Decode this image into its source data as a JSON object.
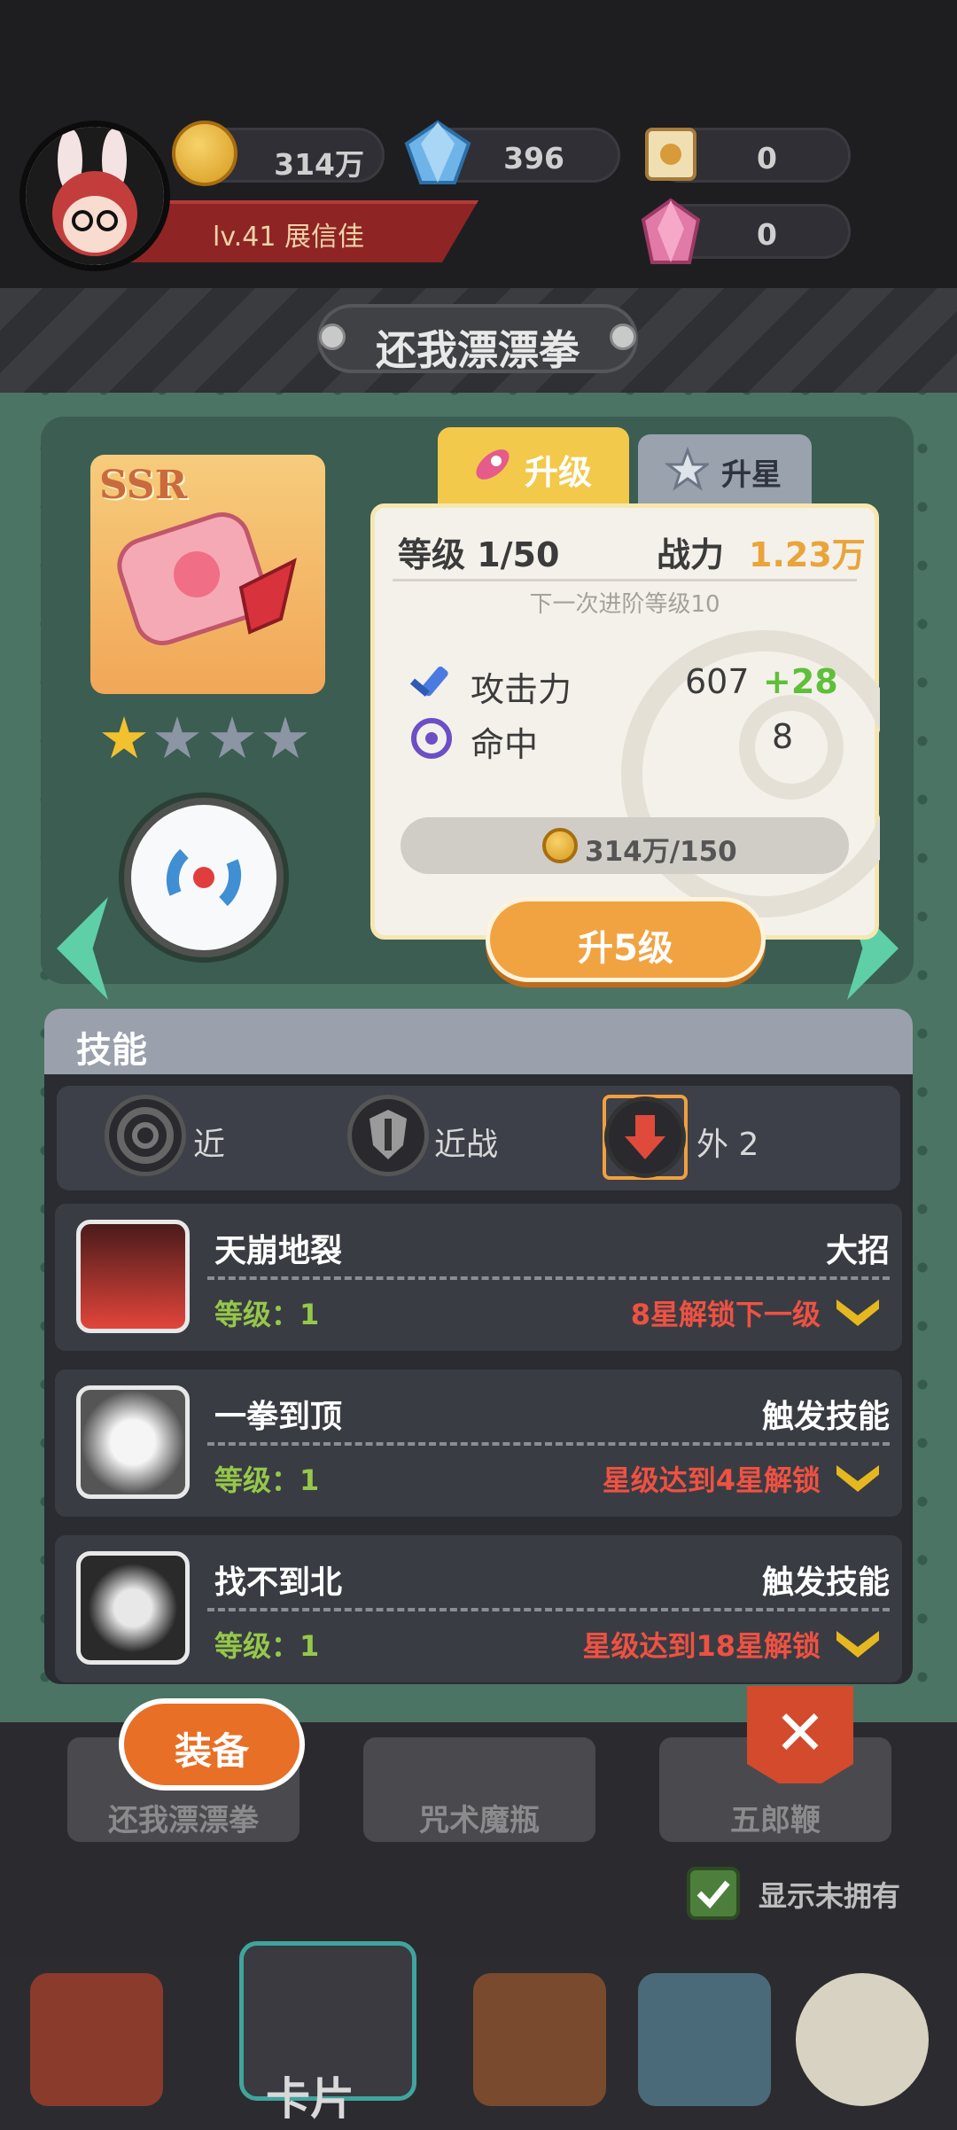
{
  "player": {
    "level_name": "lv.41  展信佳"
  },
  "currencies": {
    "gold": "314万",
    "diamond": "396",
    "scroll": "0",
    "gem": "0"
  },
  "title": "还我漂漂拳",
  "card": {
    "rarity": "SSR",
    "stars_filled": 1,
    "stars_total": 4
  },
  "tabs": {
    "upgrade": "升级",
    "star_up": "升星"
  },
  "stats": {
    "level_label": "等级 1/50",
    "power_label": "战力",
    "power_value": "1.23万",
    "next_advance": "下一次进阶等级10",
    "attack_label": "攻击力",
    "attack_value": "607",
    "attack_bonus": "+28",
    "hit_label": "命中",
    "hit_value": "8",
    "cost": "314万/150",
    "upgrade_button": "升5级"
  },
  "skills": {
    "header": "技能",
    "filters": [
      {
        "label": "近"
      },
      {
        "label": "近战"
      },
      {
        "label": "外 2"
      }
    ],
    "items": [
      {
        "name": "天崩地裂",
        "type": "大招",
        "level": "等级：1",
        "unlock": "8星解锁下一级"
      },
      {
        "name": "一拳到顶",
        "type": "触发技能",
        "level": "等级：1",
        "unlock": "星级达到4星解锁"
      },
      {
        "name": "找不到北",
        "type": "触发技能",
        "level": "等级：1",
        "unlock": "星级达到18星解锁"
      }
    ]
  },
  "bottom": {
    "equip_button": "装备",
    "close_symbol": "✕",
    "cards": [
      "还我漂漂拳",
      "咒术魔瓶",
      "五郎鞭"
    ],
    "show_unowned": "显示未拥有",
    "nav_label": "卡片"
  },
  "colors": {
    "accent_orange": "#f1a341",
    "bonus_green": "#5fbf3a",
    "lock_red": "#ef5142",
    "power_orange": "#e9a43a"
  }
}
